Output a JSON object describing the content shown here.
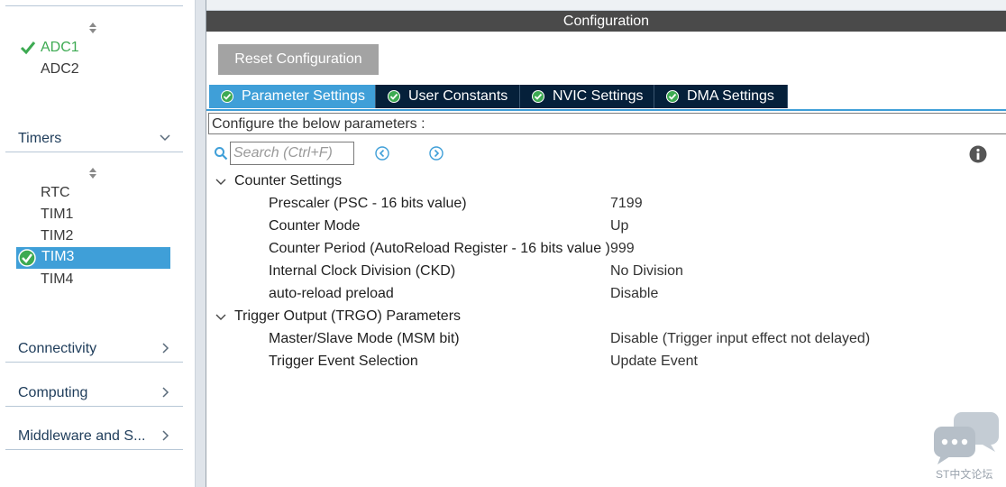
{
  "left_panel": {
    "adc_items": [
      {
        "label": "ADC1",
        "checked": true
      },
      {
        "label": "ADC2",
        "checked": false
      }
    ],
    "timers": {
      "label": "Timers",
      "items": [
        "RTC",
        "TIM1",
        "TIM2",
        "TIM3",
        "TIM4"
      ],
      "selected": "TIM3"
    },
    "categories": [
      "Connectivity",
      "Computing",
      "Middleware and S..."
    ]
  },
  "config": {
    "title": "Configuration",
    "reset_label": "Reset Configuration",
    "tabs": [
      {
        "label": "Parameter Settings",
        "active": true
      },
      {
        "label": "User Constants",
        "active": false
      },
      {
        "label": "NVIC Settings",
        "active": false
      },
      {
        "label": "DMA Settings",
        "active": false
      }
    ],
    "hint": "Configure the below parameters :",
    "search": {
      "placeholder": "Search (Ctrl+F)"
    },
    "groups": [
      {
        "label": "Counter Settings",
        "params": [
          {
            "name": "Prescaler (PSC - 16 bits value)",
            "value": "7199"
          },
          {
            "name": "Counter Mode",
            "value": "Up"
          },
          {
            "name": "Counter Period (AutoReload Register - 16 bits value )",
            "value": "999"
          },
          {
            "name": "Internal Clock Division (CKD)",
            "value": "No Division"
          },
          {
            "name": "auto-reload preload",
            "value": "Disable"
          }
        ]
      },
      {
        "label": "Trigger Output (TRGO) Parameters",
        "params": [
          {
            "name": "Master/Slave Mode (MSM bit)",
            "value": "Disable (Trigger input effect not delayed)"
          },
          {
            "name": "Trigger Event Selection",
            "value": "Update Event"
          }
        ]
      }
    ]
  },
  "watermark": {
    "text": "ST中文论坛"
  },
  "colors": {
    "accent": "#3f9fd8",
    "tab_dark": "#05203a",
    "title_bar": "#4a4a4a",
    "check_green": "#3daa52"
  }
}
